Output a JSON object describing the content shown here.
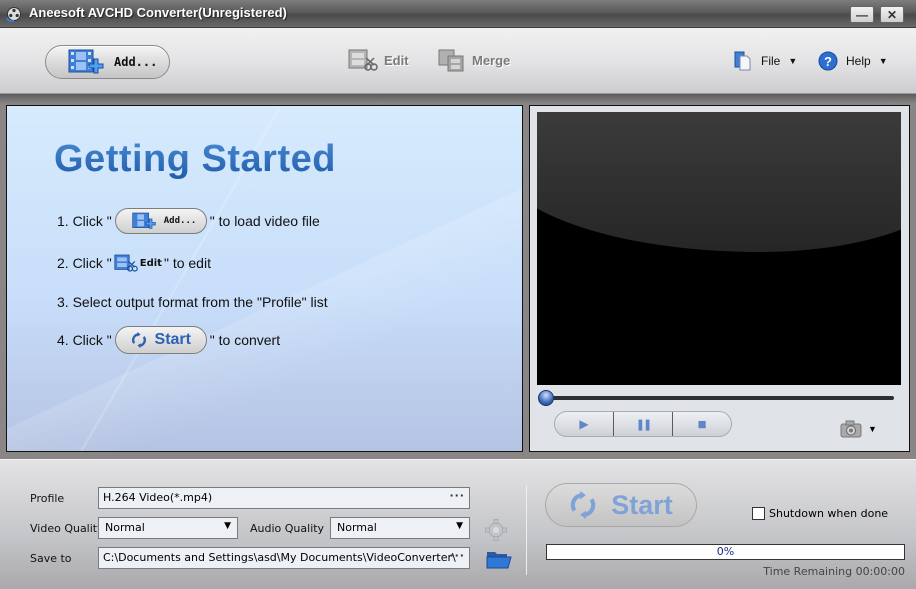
{
  "window": {
    "title": "Aneesoft AVCHD Converter(Unregistered)",
    "minimize_label": "—",
    "close_label": "✕"
  },
  "toolbar": {
    "add_label": "Add...",
    "edit_label": "Edit",
    "merge_label": "Merge",
    "file_label": "File",
    "help_label": "Help",
    "caret": "▼"
  },
  "getting_started": {
    "title": "Getting Started",
    "steps": [
      {
        "prefix": "1. Click \"",
        "button": "Add...",
        "suffix": "\" to load video file"
      },
      {
        "prefix": "2. Click \"",
        "button": "Edit",
        "suffix": " \" to edit"
      },
      {
        "prefix": "3. Select output format from the \"Profile\" list",
        "button": "",
        "suffix": ""
      },
      {
        "prefix": "4. Click \"",
        "button": "Start",
        "suffix": "\" to convert"
      }
    ]
  },
  "player": {
    "seek_position": 0,
    "play_icon": "▶",
    "pause_icon": "❚❚",
    "stop_icon": "■",
    "caret": "▼"
  },
  "settings": {
    "profile_label": "Profile",
    "profile_value": "H.264 Video(*.mp4)",
    "video_quality_label": "Video Quality",
    "video_quality_value": "Normal",
    "audio_quality_label": "Audio Quality",
    "audio_quality_value": "Normal",
    "save_to_label": "Save to",
    "save_to_value": "C:\\Documents and Settings\\asd\\My Documents\\VideoConverter\\",
    "browse_label": "···",
    "dropdown_arrow": "▼"
  },
  "convert": {
    "start_label": "Start",
    "shutdown_label": "Shutdown when done",
    "shutdown_checked": false,
    "progress_percent": 0,
    "progress_text": "0%",
    "time_remaining": "Time Remaining 00:00:00"
  }
}
